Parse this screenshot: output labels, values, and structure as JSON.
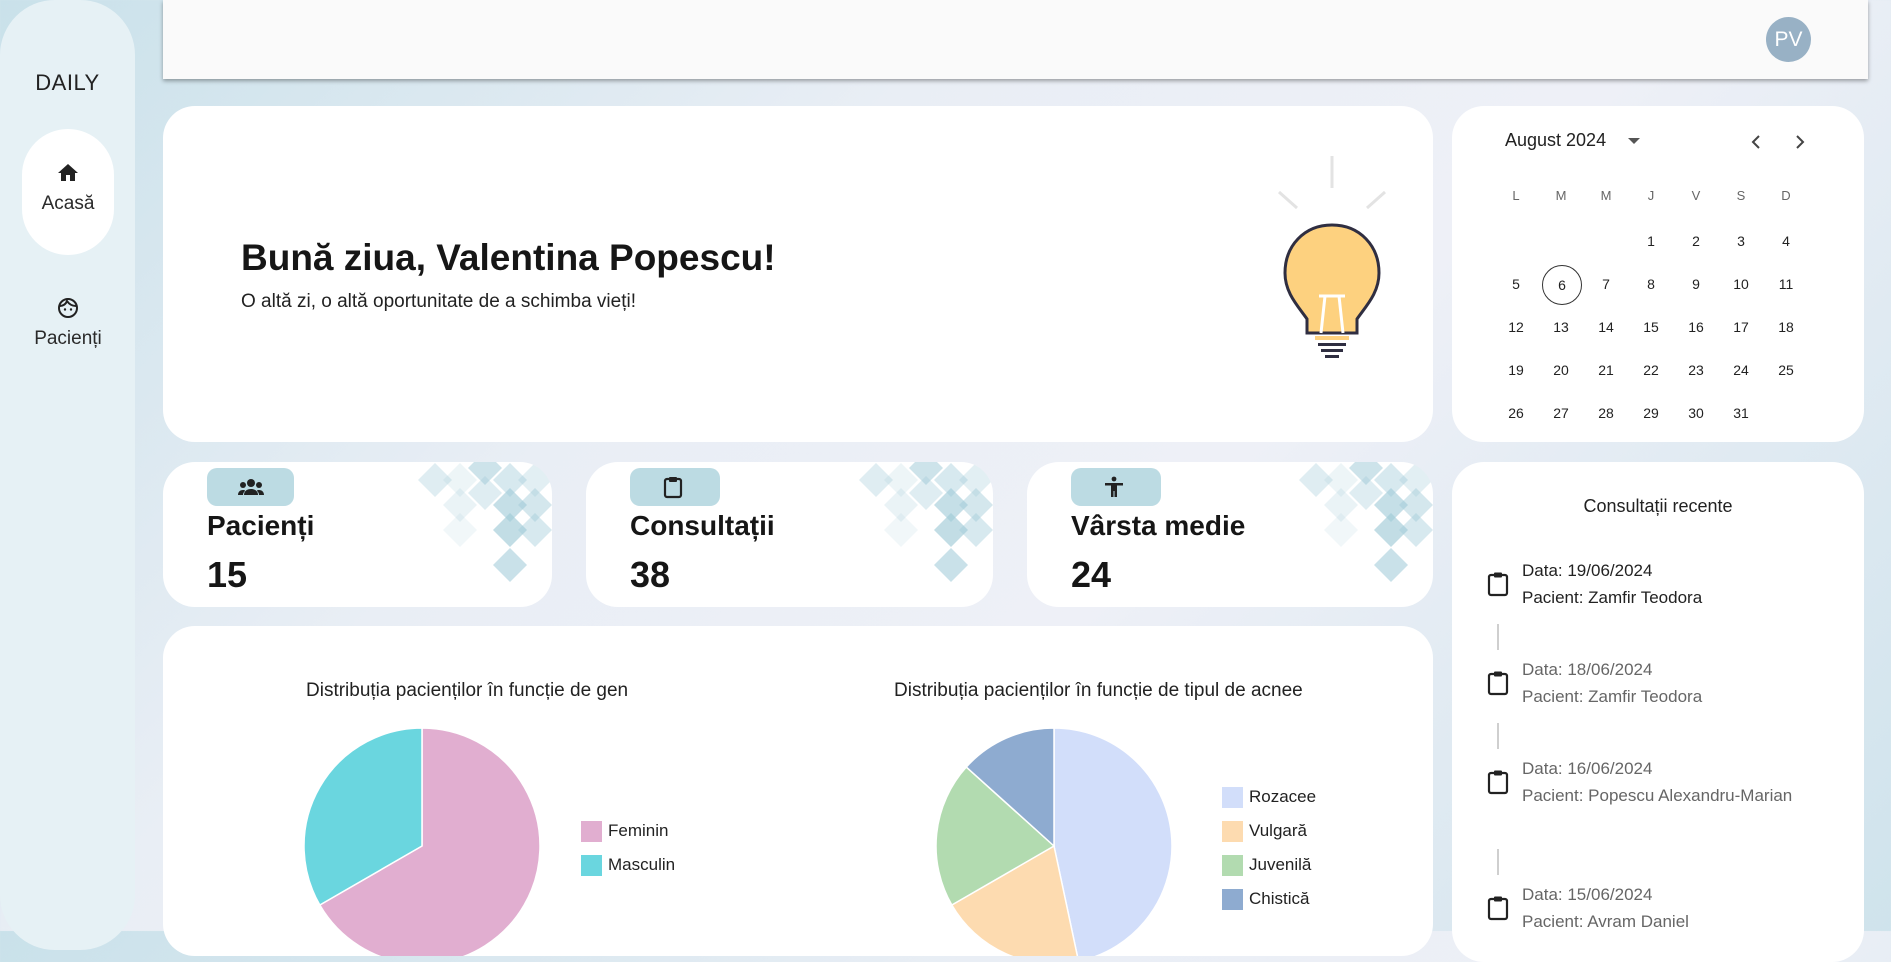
{
  "sidebar": {
    "brand": "DAILY",
    "items": [
      {
        "label": "Acasă",
        "icon": "home-icon",
        "active": true
      },
      {
        "label": "Pacienți",
        "icon": "face-icon",
        "active": false
      }
    ]
  },
  "topbar": {
    "avatar": "PV"
  },
  "hero": {
    "greeting": "Bună ziua, Valentina Popescu!",
    "subtitle": "O altă zi, o altă oportunitate de a schimba vieți!"
  },
  "calendar": {
    "month": "August 2024",
    "weekdays": [
      "L",
      "M",
      "M",
      "J",
      "V",
      "S",
      "D"
    ],
    "first_weekday_index": 3,
    "days_in_month": 31,
    "today": 6
  },
  "stats": [
    {
      "title": "Pacienți",
      "value": "15",
      "icon": "group-icon"
    },
    {
      "title": "Consultații",
      "value": "38",
      "icon": "clipboard-icon"
    },
    {
      "title": "Vârsta medie",
      "value": "24",
      "icon": "accessibility-icon"
    }
  ],
  "charts": {
    "gender_title": "Distribuția pacienților în funcție de gen",
    "acne_title": "Distribuția pacienților în funcție de tipul de acnee"
  },
  "chart_data": [
    {
      "type": "pie",
      "title": "Distribuția pacienților în funcție de gen",
      "categories": [
        "Feminin",
        "Masculin"
      ],
      "values": [
        10,
        5
      ],
      "colors": [
        "#e1aed0",
        "#6ad6df"
      ],
      "legend": "right"
    },
    {
      "type": "pie",
      "title": "Distribuția pacienților în funcție de tipul de acnee",
      "categories": [
        "Rozacee",
        "Vulgară",
        "Juvenilă",
        "Chistică"
      ],
      "values": [
        7,
        3,
        3,
        2
      ],
      "colors": [
        "#d2defa",
        "#fddbb0",
        "#b2dbb0",
        "#8eabd0"
      ],
      "legend": "right"
    }
  ],
  "recent": {
    "title": "Consultații recente",
    "items": [
      {
        "date": "Data: 19/06/2024",
        "patient": "Pacient: Zamfir Teodora",
        "dim": false
      },
      {
        "date": "Data: 18/06/2024",
        "patient": "Pacient: Zamfir Teodora",
        "dim": true
      },
      {
        "date": "Data: 16/06/2024",
        "patient": "Pacient: Popescu Alexandru-Marian",
        "dim": true
      },
      {
        "date": "Data: 15/06/2024",
        "patient": "Pacient: Avram Daniel",
        "dim": true
      }
    ]
  }
}
